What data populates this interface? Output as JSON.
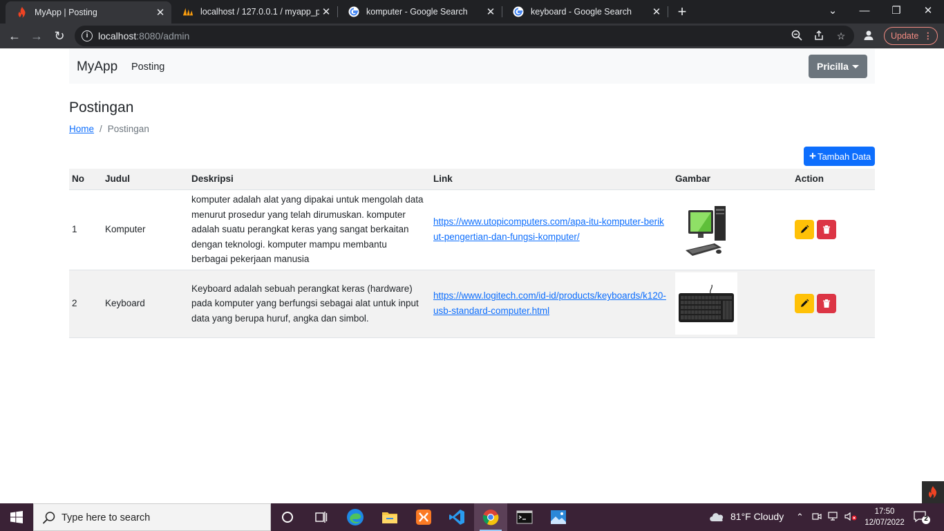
{
  "browser": {
    "tabs": [
      {
        "title": "MyApp | Posting",
        "active": true
      },
      {
        "title": "localhost / 127.0.0.1 / myapp_pri",
        "active": false
      },
      {
        "title": "komputer - Google Search",
        "active": false
      },
      {
        "title": "keyboard - Google Search",
        "active": false
      }
    ],
    "url_host": "localhost",
    "url_rest": ":8080/admin",
    "update_label": "Update"
  },
  "navbar": {
    "brand": "MyApp",
    "link": "Posting",
    "user": "Pricilla"
  },
  "page": {
    "title": "Postingan",
    "breadcrumb_home": "Home",
    "breadcrumb_sep": "/",
    "breadcrumb_current": "Postingan",
    "add_label": "Tambah Data"
  },
  "table": {
    "headers": [
      "No",
      "Judul",
      "Deskripsi",
      "Link",
      "Gambar",
      "Action"
    ],
    "rows": [
      {
        "no": "1",
        "judul": "Komputer",
        "deskripsi": "komputer adalah alat yang dipakai untuk mengolah data menurut prosedur yang telah dirumuskan. komputer adalah suatu perangkat keras yang sangat berkaitan dengan teknologi. komputer mampu membantu berbagai pekerjaan manusia",
        "link": "https://www.utopicomputers.com/apa-itu-komputer-berikut-pengertian-dan-fungsi-komputer/",
        "gambar": "computer-image"
      },
      {
        "no": "2",
        "judul": "Keyboard",
        "deskripsi": "Keyboard adalah sebuah perangkat keras (hardware) pada komputer yang berfungsi sebagai alat untuk input data yang berupa huruf, angka dan simbol.",
        "link": "https://www.logitech.com/id-id/products/keyboards/k120-usb-standard-computer.html",
        "gambar": "keyboard-image"
      }
    ]
  },
  "taskbar": {
    "search_placeholder": "Type here to search",
    "weather": "81°F  Cloudy",
    "time": "17:50",
    "date": "12/07/2022",
    "notifications": "2"
  },
  "colors": {
    "primary": "#0d6efd",
    "warning": "#ffc107",
    "danger": "#dc3545",
    "secondary": "#6c757d"
  }
}
